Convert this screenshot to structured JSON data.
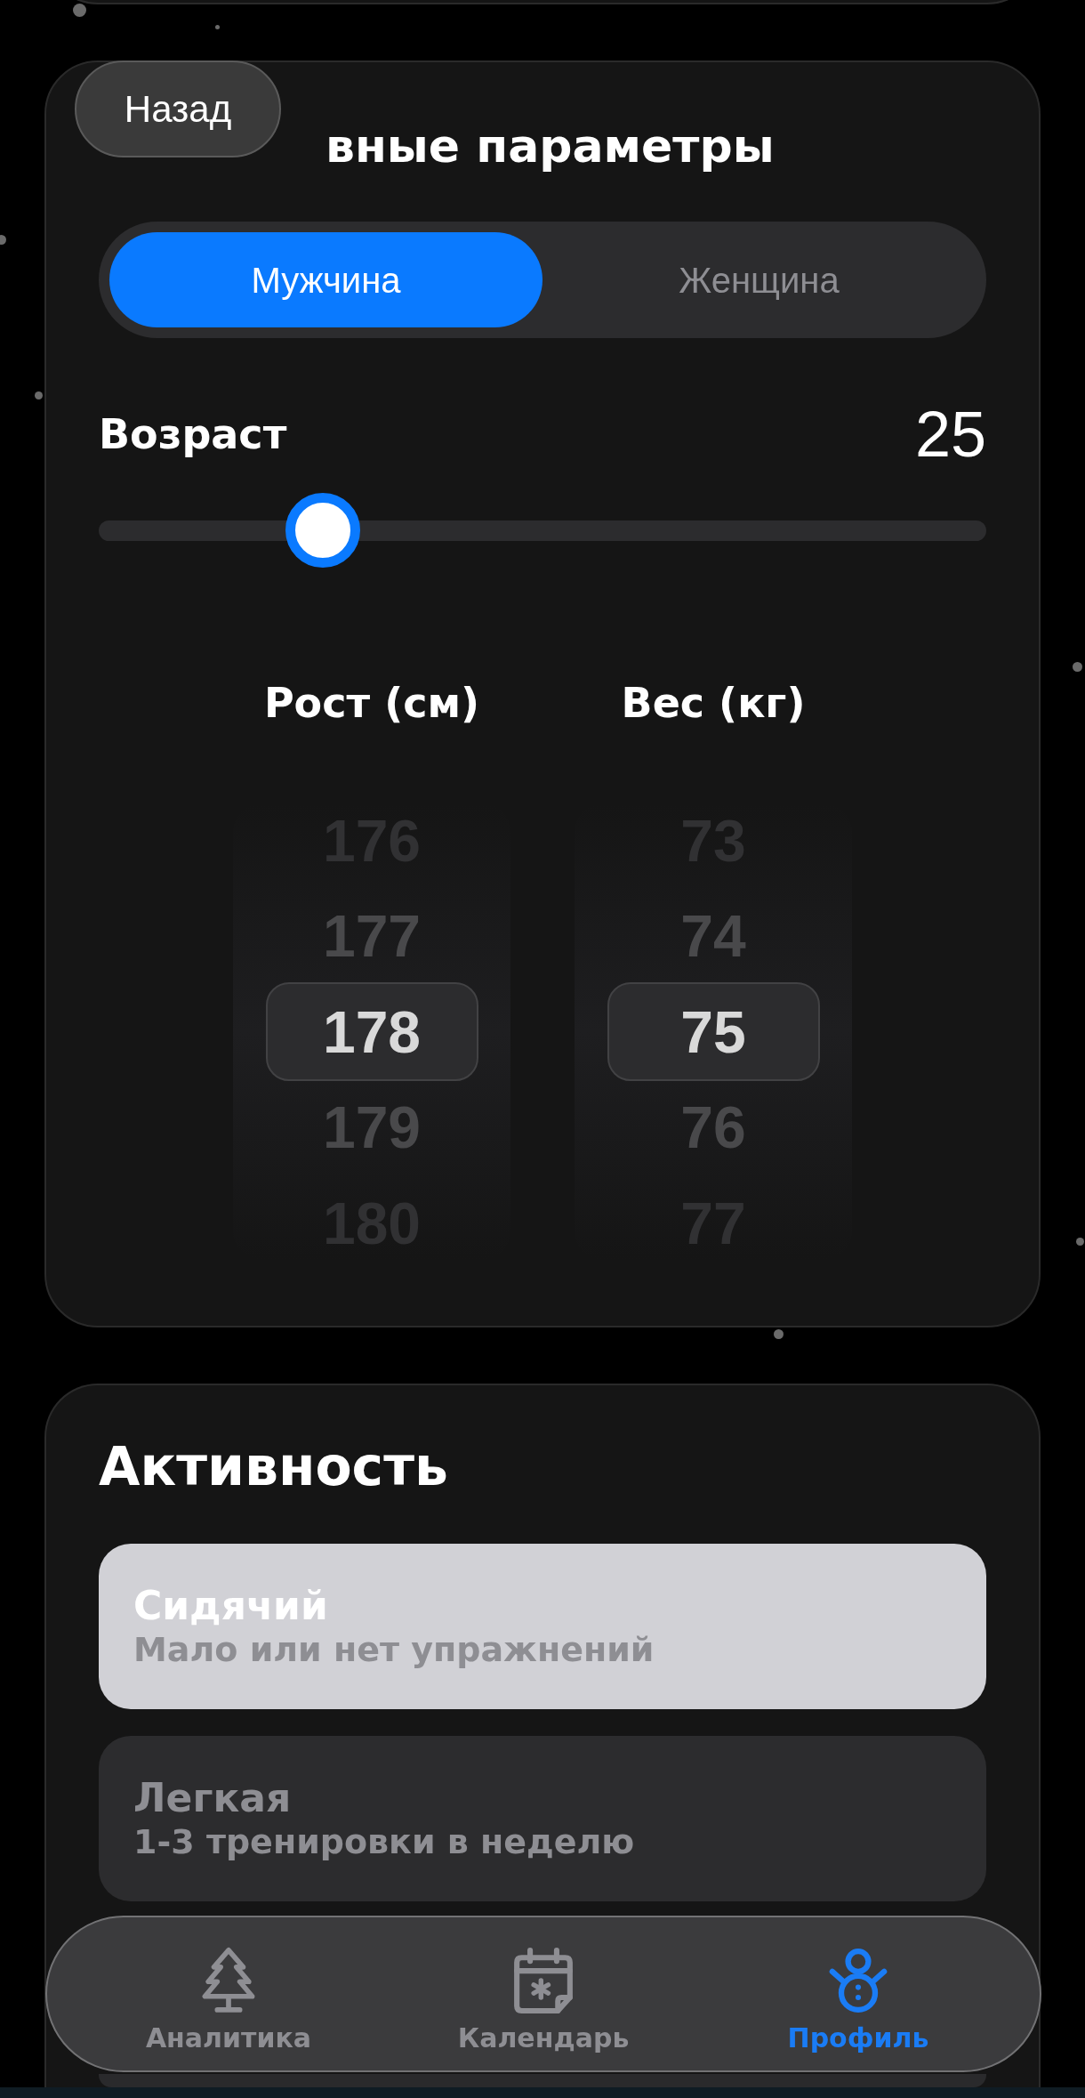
{
  "back_button": {
    "label": "Назад"
  },
  "parameters": {
    "title": "вные параметры",
    "gender": [
      {
        "label": "Мужчина",
        "selected": true
      },
      {
        "label": "Женщина",
        "selected": false
      }
    ],
    "age": {
      "label": "Возраст",
      "value": "25",
      "level": 0.23
    },
    "pickers": [
      {
        "label": "Рост (см)",
        "items": [
          {
            "value": "176",
            "selected": false
          },
          {
            "value": "177",
            "selected": false
          },
          {
            "value": "178",
            "selected": true
          },
          {
            "value": "179",
            "selected": false
          },
          {
            "value": "180",
            "selected": false
          }
        ]
      },
      {
        "label": "Вес (кг)",
        "items": [
          {
            "value": "73",
            "selected": false
          },
          {
            "value": "74",
            "selected": false
          },
          {
            "value": "75",
            "selected": true
          },
          {
            "value": "76",
            "selected": false
          },
          {
            "value": "77",
            "selected": false
          }
        ]
      }
    ]
  },
  "activity": {
    "title": "Активность",
    "options": [
      {
        "title": "Сидячий",
        "subtitle": "Мало или нет упражнений",
        "selected": true
      },
      {
        "title": "Легкая",
        "subtitle": "1-3 тренировки в неделю",
        "selected": false
      }
    ]
  },
  "bottom_nav": [
    {
      "label": "Аналитика",
      "selected": false
    },
    {
      "label": "Календарь",
      "selected": false
    },
    {
      "label": "Профиль",
      "selected": true
    }
  ]
}
